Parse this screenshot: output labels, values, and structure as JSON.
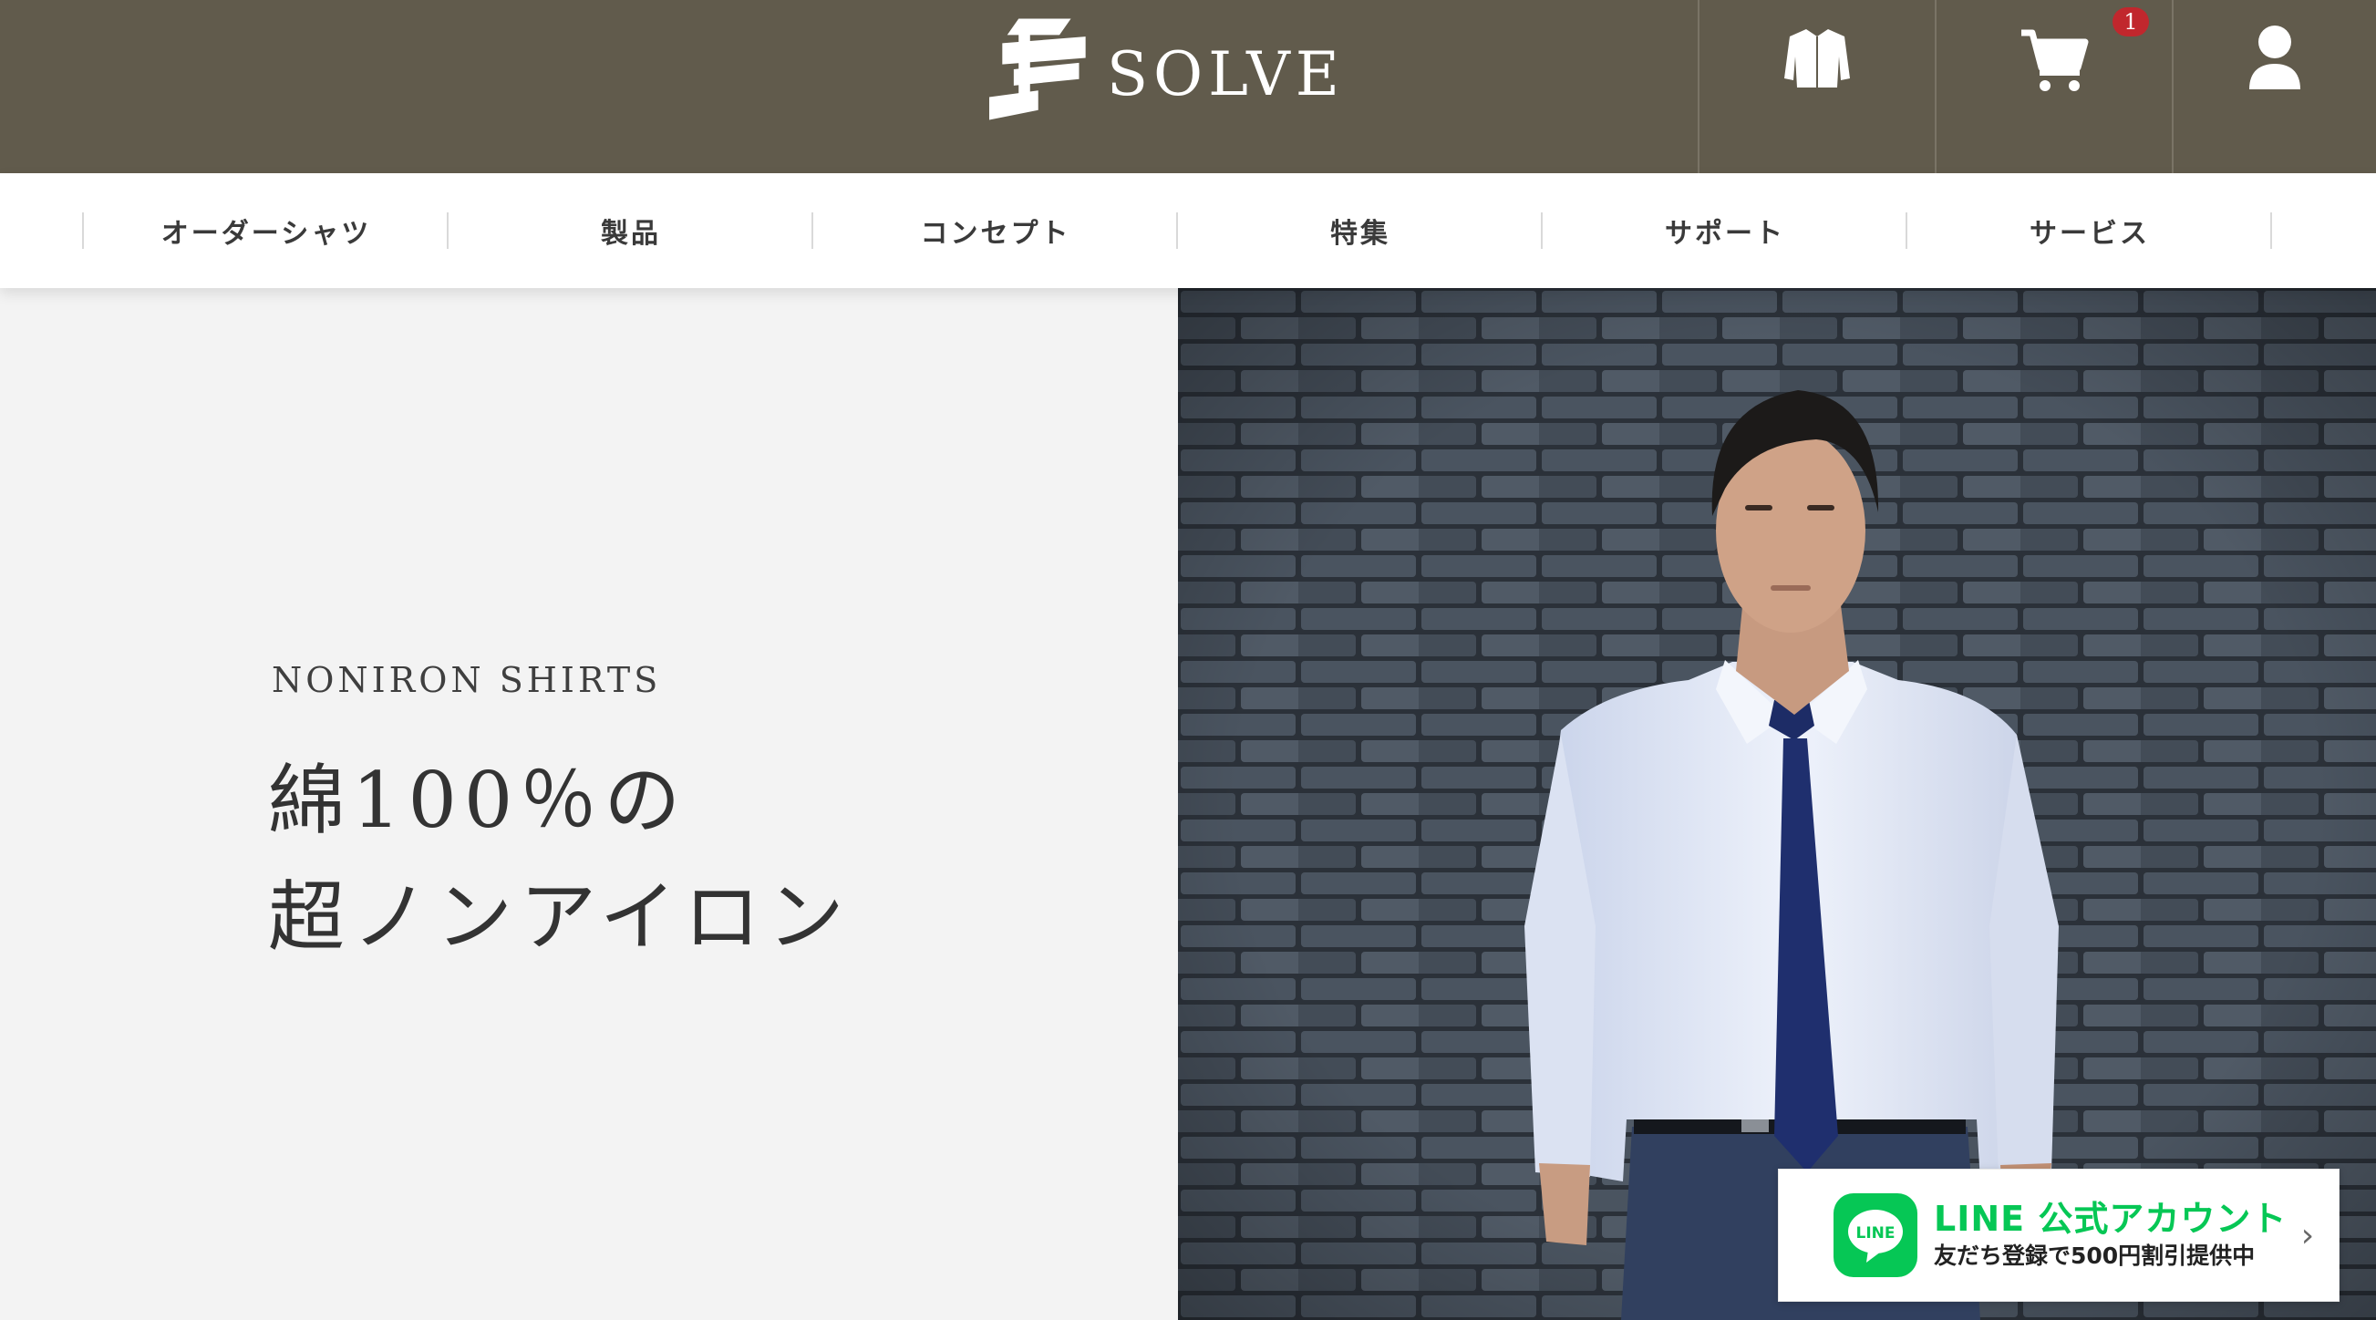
{
  "brand": {
    "name": "SOLVE"
  },
  "header": {
    "cart_count": "1",
    "icons": [
      "shirt-icon",
      "cart-icon",
      "user-icon"
    ]
  },
  "nav": {
    "items": [
      {
        "label": "オーダーシャツ"
      },
      {
        "label": "製品"
      },
      {
        "label": "コンセプト"
      },
      {
        "label": "特集"
      },
      {
        "label": "サポート"
      },
      {
        "label": "サービス"
      }
    ]
  },
  "hero": {
    "eyebrow": "NONIRON SHIRTS",
    "headline_line1": "綿100％の",
    "headline_line2": "超ノンアイロン"
  },
  "line_banner": {
    "logo_text": "LINE",
    "title": "LINE 公式アカウント",
    "subtitle": "友だち登録で500円割引提供中"
  },
  "colors": {
    "header_bg": "#615b4c",
    "nav_bg": "#ffffff",
    "hero_left_bg": "#f3f3f3",
    "line_green": "#06c755",
    "badge_red": "#c1272d"
  }
}
